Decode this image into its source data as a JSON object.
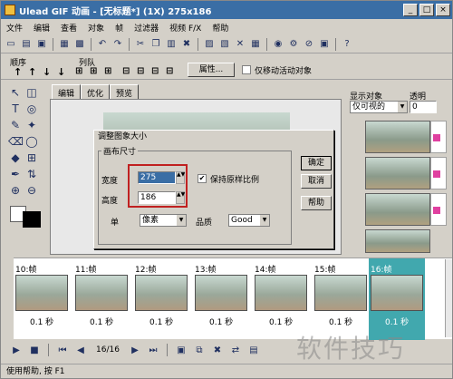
{
  "window": {
    "title": "Ulead GIF 动画 - [无标题*] (1X) 275x186",
    "buttons": {
      "minimize": "_",
      "maximize": "□",
      "close": "×"
    }
  },
  "menu": [
    "文件",
    "编辑",
    "查看",
    "对象",
    "帧",
    "过滤器",
    "视频 F/X",
    "帮助"
  ],
  "toolbar": {
    "icons": [
      "new-icon",
      "open-icon",
      "save-icon",
      "image-icon",
      "undo-icon",
      "redo-icon",
      "cut-icon",
      "copy-icon",
      "paste-icon",
      "delete-icon",
      "print-icon",
      "help-icon"
    ]
  },
  "layer_bar": {
    "order_label": "顺序",
    "align_label": "列队",
    "properties_label": "属性...",
    "only_active_label": "仅移动活动对象"
  },
  "tabs": [
    "编辑",
    "优化",
    "预览"
  ],
  "right_panel": {
    "display_objects_label": "显示对象",
    "transparency_label": "透明",
    "display_select": "仅可视的",
    "transparency_value": "0"
  },
  "dialog": {
    "title": "调整图象大小",
    "group_label": "画布尺寸",
    "width_label": "宽度",
    "width_value": "275",
    "height_label": "高度",
    "height_value": "186",
    "keep_ratio_label": "保持原样比例",
    "unit_label": "单",
    "unit_value": "像素",
    "quality_label": "品质",
    "quality_value": "Good",
    "ok_label": "确定",
    "cancel_label": "取消",
    "help_label": "帮助"
  },
  "frames": [
    {
      "label": "10:帧",
      "time": "0.1 秒"
    },
    {
      "label": "11:帧",
      "time": "0.1 秒"
    },
    {
      "label": "12:帧",
      "time": "0.1 秒"
    },
    {
      "label": "13:帧",
      "time": "0.1 秒"
    },
    {
      "label": "14:帧",
      "time": "0.1 秒"
    },
    {
      "label": "15:帧",
      "time": "0.1 秒"
    },
    {
      "label": "16:帧",
      "time": "0.1 秒"
    }
  ],
  "playback": {
    "frame_counter": "16/16"
  },
  "status": {
    "text": "使用帮助, 按 F1"
  },
  "watermark": "软件技巧",
  "colors": {
    "title_bar": "#3a6ea5",
    "selected_frame": "#41a8ae",
    "highlight_border": "#c02020"
  }
}
